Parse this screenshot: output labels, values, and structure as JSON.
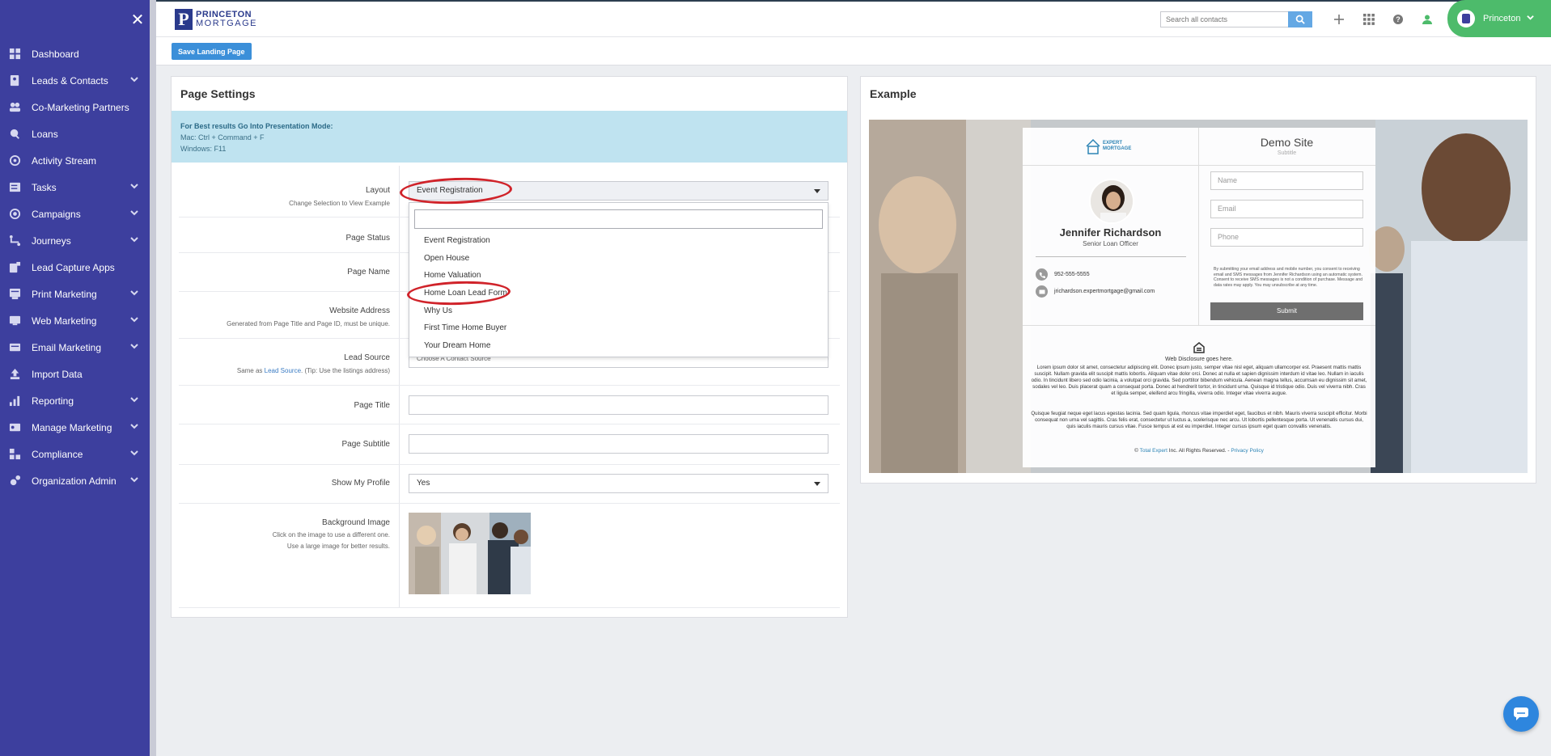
{
  "sidebar": {
    "items": [
      {
        "label": "Dashboard",
        "icon": "dashboard-icon",
        "chevron": false
      },
      {
        "label": "Leads & Contacts",
        "icon": "contacts-icon",
        "chevron": true
      },
      {
        "label": "Co-Marketing Partners",
        "icon": "partners-icon",
        "chevron": false
      },
      {
        "label": "Loans",
        "icon": "loans-icon",
        "chevron": false
      },
      {
        "label": "Activity Stream",
        "icon": "activity-icon",
        "chevron": false
      },
      {
        "label": "Tasks",
        "icon": "tasks-icon",
        "chevron": true
      },
      {
        "label": "Campaigns",
        "icon": "campaigns-icon",
        "chevron": true
      },
      {
        "label": "Journeys",
        "icon": "journeys-icon",
        "chevron": true
      },
      {
        "label": "Lead Capture Apps",
        "icon": "lead-capture-icon",
        "chevron": false
      },
      {
        "label": "Print Marketing",
        "icon": "print-icon",
        "chevron": true
      },
      {
        "label": "Web Marketing",
        "icon": "web-icon",
        "chevron": true
      },
      {
        "label": "Email Marketing",
        "icon": "email-icon",
        "chevron": true
      },
      {
        "label": "Import Data",
        "icon": "import-icon",
        "chevron": false
      },
      {
        "label": "Reporting",
        "icon": "reporting-icon",
        "chevron": true
      },
      {
        "label": "Manage Marketing",
        "icon": "manage-marketing-icon",
        "chevron": true
      },
      {
        "label": "Compliance",
        "icon": "compliance-icon",
        "chevron": true
      },
      {
        "label": "Organization Admin",
        "icon": "org-admin-icon",
        "chevron": true
      }
    ]
  },
  "header": {
    "logo_line1": "PRINCETON",
    "logo_line2": "MORTGAGE",
    "search_placeholder": "Search all contacts",
    "user_name": "Princeton"
  },
  "actionbar": {
    "save_label": "Save Landing Page"
  },
  "settings": {
    "title": "Page Settings",
    "info_title": "For Best results Go Into Presentation Mode:",
    "info_mac": "Mac: Ctrl + Command + F",
    "info_win": "Windows: F11",
    "layout_label": "Layout",
    "layout_hint": "Change Selection to View Example",
    "layout_value": "Event Registration",
    "status_label": "Page Status",
    "name_label": "Page Name",
    "website_label": "Website Address",
    "website_hint": "Generated from Page Title and Page ID, must be unique.",
    "lead_source_label": "Lead Source",
    "lead_source_hint_pre": "Same as ",
    "lead_source_hint_link": "Lead Source",
    "lead_source_hint_post": ". (Tip: Use the listings address)",
    "lead_source_value": "Choose A Contact Source",
    "page_title_label": "Page Title",
    "page_subtitle_label": "Page Subtitle",
    "show_profile_label": "Show My Profile",
    "show_profile_value": "Yes",
    "bg_label": "Background Image",
    "bg_hint1": "Click on the image to use a different one.",
    "bg_hint2": "Use a large image for better results.",
    "layout_options": [
      "Event Registration",
      "Open House",
      "Home Valuation",
      "Home Loan Lead Form",
      "Why Us",
      "First Time Home Buyer",
      "Your Dream Home"
    ]
  },
  "example": {
    "title": "Example",
    "logo_line1": "EXPERT",
    "logo_line2": "MORTGAGE",
    "site_title": "Demo Site",
    "site_subtitle": "Subtitle",
    "agent_name": "Jennifer Richardson",
    "agent_role": "Senior Loan Officer",
    "phone": "952-555-5555",
    "email": "jrichardson.expertmortgage@gmail.com",
    "input_name": "Name",
    "input_email": "Email",
    "input_phone": "Phone",
    "consent": "By submitting your email address and mobile number, you consent to receiving email and SMS messages from Jennifer Richardson using an automatic system. Consent to receive SMS messages is not a condition of purchase. Message and data rates may apply. You may unsubscribe at any time.",
    "submit_label": "Submit",
    "disclosure": "Web Disclosure goes here.",
    "lorem1": "Lorem ipsum dolor sit amet, consectetur adipiscing elit. Donec ipsum justo, semper vitae nisl eget, aliquam ullamcorper est. Praesent mattis mattis suscipit. Nullam gravida elit suscipit mattis lobortis. Aliquam vitae dolor orci. Donec at nulla et sapien dignissim interdum id vitae leo. Nullam in iaculis odio. In tincidunt libero sed odio lacinia, a volutpat orci gravida. Sed porttitor bibendum vehicula. Aenean magna tellus, accumsan eu dignissim sit amet, sodales vel leo. Duis placerat quam a consequat porta. Donec at hendrerit tortor, in tincidunt urna. Quisque id tristique odio. Duis vel viverra nibh. Cras et ligula semper, eleifend arcu fringilla, viverra odio. Integer vitae viverra augue.",
    "lorem2": "Quisque feugiat neque eget lacus egestas lacinia. Sed quam ligula, rhoncus vitae imperdiet eget, faucibus et nibh. Mauris viverra suscipit efficitur. Morbi consequat non urna vel sagittis. Cras felis erat, consectetur ut luctus a, scelerisque nec arcu. Ut lobortis pellentesque porta. Ut venenatis cursus dui, quis iaculis mauris cursus vitae. Fusce tempus at est eu imperdiet. Integer cursus ipsum eget quam convallis venenatis.",
    "footer_pre": "© ",
    "footer_link": "Total Expert",
    "footer_mid": " Inc. All Rights Reserved. - ",
    "footer_privacy": "Privacy Policy"
  },
  "colors": {
    "sidebar": "#3d3f9e",
    "accent": "#3b8fd9",
    "user_pill": "#4dbb6b",
    "annotation": "#d0232a"
  }
}
